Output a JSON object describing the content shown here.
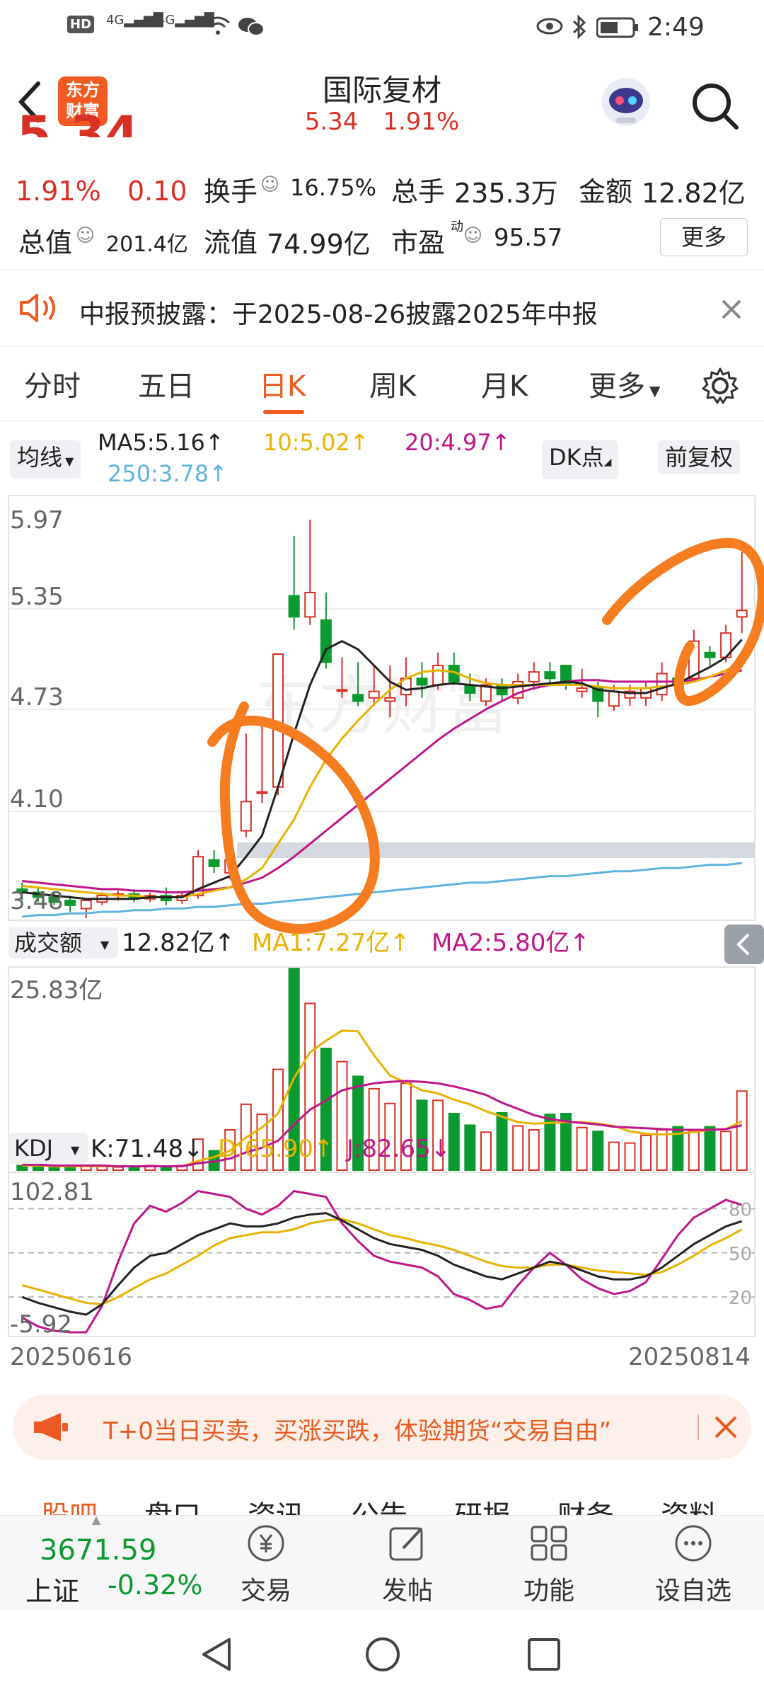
{
  "status_bar": {
    "left_icons": [
      "hd-icon",
      "4g-signal-icon",
      "4g-signal-icon",
      "wifi-icon",
      "wechat-icon"
    ],
    "hd_label": "HD",
    "sim1": "4G",
    "sim2": "4G",
    "time": "2:49"
  },
  "header": {
    "app_logo_line1": "东方",
    "app_logo_line2": "财富",
    "stock_name": "国际复材",
    "price": "5.34",
    "change_pct": "1.91%"
  },
  "quote": {
    "big_price": "5.34",
    "change_pct": "1.91%",
    "change_amt": "0.10",
    "turnover_label": "换手",
    "turnover_value": "16.75%",
    "total_hands_label": "总手",
    "total_hands_value": "235.3万",
    "amount_label": "金额",
    "amount_value": "12.82亿",
    "total_value_label": "总值",
    "total_value_value": "201.4亿",
    "float_value_label": "流值",
    "float_value_value": "74.99亿",
    "pe_label": "市盈",
    "pe_superscript": "动",
    "pe_value": "95.57",
    "more_button": "更多"
  },
  "notice": {
    "text": "中报预披露：于2025-08-26披露2025年中报"
  },
  "tabs": [
    "分时",
    "五日",
    "日K",
    "周K",
    "月K",
    "更多"
  ],
  "active_tab": "日K",
  "ma_row": {
    "selector": "均线",
    "ma5": "MA5:5.16",
    "ma10": "10:5.02",
    "ma20": "20:4.97",
    "ma250": "250:3.78",
    "dk_button": "DK点",
    "adjust_button": "前复权",
    "colors": {
      "ma5": "#222222",
      "ma10": "#e8b200",
      "ma20": "#c0168a",
      "ma250": "#5fb3e0"
    }
  },
  "chart_data": [
    {
      "type": "candlestick",
      "y_tick_labels": [
        "5.97",
        "5.35",
        "4.73",
        "4.10",
        "3.48"
      ],
      "ylim": [
        3.48,
        5.97
      ],
      "x_start": "20250616",
      "x_end": "20250814",
      "candles": [
        {
          "o": 3.62,
          "h": 3.66,
          "l": 3.55,
          "c": 3.6
        },
        {
          "o": 3.6,
          "h": 3.63,
          "l": 3.54,
          "c": 3.57
        },
        {
          "o": 3.57,
          "h": 3.6,
          "l": 3.52,
          "c": 3.54
        },
        {
          "o": 3.55,
          "h": 3.58,
          "l": 3.48,
          "c": 3.52
        },
        {
          "o": 3.5,
          "h": 3.56,
          "l": 3.44,
          "c": 3.55
        },
        {
          "o": 3.54,
          "h": 3.6,
          "l": 3.52,
          "c": 3.58
        },
        {
          "o": 3.58,
          "h": 3.61,
          "l": 3.55,
          "c": 3.59
        },
        {
          "o": 3.59,
          "h": 3.62,
          "l": 3.54,
          "c": 3.56
        },
        {
          "o": 3.56,
          "h": 3.6,
          "l": 3.54,
          "c": 3.58
        },
        {
          "o": 3.58,
          "h": 3.63,
          "l": 3.52,
          "c": 3.55
        },
        {
          "o": 3.55,
          "h": 3.6,
          "l": 3.53,
          "c": 3.58
        },
        {
          "o": 3.58,
          "h": 3.86,
          "l": 3.56,
          "c": 3.82
        },
        {
          "o": 3.8,
          "h": 3.86,
          "l": 3.72,
          "c": 3.76
        },
        {
          "o": 3.72,
          "h": 3.82,
          "l": 3.68,
          "c": 3.8
        },
        {
          "o": 3.98,
          "h": 4.58,
          "l": 3.94,
          "c": 4.16
        },
        {
          "o": 4.22,
          "h": 4.68,
          "l": 4.15,
          "c": 4.22
        },
        {
          "o": 4.25,
          "h": 5.07,
          "l": 4.2,
          "c": 5.07
        },
        {
          "o": 5.43,
          "h": 5.8,
          "l": 5.22,
          "c": 5.3
        },
        {
          "o": 5.3,
          "h": 5.9,
          "l": 5.25,
          "c": 5.45
        },
        {
          "o": 5.28,
          "h": 5.45,
          "l": 4.98,
          "c": 5.02
        },
        {
          "o": 4.85,
          "h": 5.05,
          "l": 4.8,
          "c": 4.85
        },
        {
          "o": 4.82,
          "h": 5.02,
          "l": 4.75,
          "c": 4.78
        },
        {
          "o": 4.8,
          "h": 5.0,
          "l": 4.75,
          "c": 4.84
        },
        {
          "o": 4.78,
          "h": 5.0,
          "l": 4.68,
          "c": 4.8
        },
        {
          "o": 4.82,
          "h": 5.05,
          "l": 4.75,
          "c": 4.92
        },
        {
          "o": 4.92,
          "h": 5.02,
          "l": 4.8,
          "c": 4.88
        },
        {
          "o": 4.88,
          "h": 5.08,
          "l": 4.85,
          "c": 5.0
        },
        {
          "o": 5.0,
          "h": 5.08,
          "l": 4.88,
          "c": 4.9
        },
        {
          "o": 4.88,
          "h": 4.95,
          "l": 4.78,
          "c": 4.83
        },
        {
          "o": 4.78,
          "h": 4.92,
          "l": 4.75,
          "c": 4.88
        },
        {
          "o": 4.88,
          "h": 4.92,
          "l": 4.78,
          "c": 4.82
        },
        {
          "o": 4.8,
          "h": 4.95,
          "l": 4.76,
          "c": 4.9
        },
        {
          "o": 4.9,
          "h": 5.02,
          "l": 4.85,
          "c": 4.96
        },
        {
          "o": 4.96,
          "h": 5.02,
          "l": 4.88,
          "c": 4.92
        },
        {
          "o": 5.0,
          "h": 5.0,
          "l": 4.85,
          "c": 4.88
        },
        {
          "o": 4.84,
          "h": 4.98,
          "l": 4.8,
          "c": 4.86
        },
        {
          "o": 4.86,
          "h": 4.9,
          "l": 4.68,
          "c": 4.78
        },
        {
          "o": 4.75,
          "h": 4.88,
          "l": 4.72,
          "c": 4.84
        },
        {
          "o": 4.8,
          "h": 4.88,
          "l": 4.75,
          "c": 4.84
        },
        {
          "o": 4.8,
          "h": 4.9,
          "l": 4.75,
          "c": 4.86
        },
        {
          "o": 4.82,
          "h": 5.02,
          "l": 4.78,
          "c": 4.95
        },
        {
          "o": 4.92,
          "h": 4.98,
          "l": 4.85,
          "c": 4.88
        },
        {
          "o": 4.92,
          "h": 5.22,
          "l": 4.9,
          "c": 5.15
        },
        {
          "o": 5.08,
          "h": 5.12,
          "l": 5.0,
          "c": 5.05
        },
        {
          "o": 5.05,
          "h": 5.25,
          "l": 5.02,
          "c": 5.2
        },
        {
          "o": 5.3,
          "h": 5.7,
          "l": 5.2,
          "c": 5.34
        }
      ],
      "ma5": [
        3.6,
        3.59,
        3.58,
        3.57,
        3.56,
        3.56,
        3.56,
        3.56,
        3.57,
        3.57,
        3.57,
        3.62,
        3.66,
        3.7,
        3.82,
        3.95,
        4.25,
        4.58,
        4.88,
        5.1,
        5.15,
        5.1,
        5.0,
        4.9,
        4.85,
        4.86,
        4.88,
        4.89,
        4.88,
        4.87,
        4.86,
        4.87,
        4.88,
        4.89,
        4.9,
        4.89,
        4.85,
        4.84,
        4.83,
        4.83,
        4.86,
        4.89,
        4.94,
        4.99,
        5.05,
        5.16
      ],
      "ma10": [
        3.64,
        3.63,
        3.62,
        3.61,
        3.6,
        3.59,
        3.58,
        3.58,
        3.57,
        3.57,
        3.57,
        3.59,
        3.61,
        3.63,
        3.68,
        3.75,
        3.9,
        4.05,
        4.25,
        4.42,
        4.55,
        4.66,
        4.76,
        4.85,
        4.92,
        4.96,
        4.97,
        4.96,
        4.92,
        4.89,
        4.88,
        4.88,
        4.88,
        4.88,
        4.88,
        4.88,
        4.87,
        4.86,
        4.86,
        4.86,
        4.87,
        4.88,
        4.9,
        4.93,
        4.97,
        5.02
      ],
      "ma20": [
        3.67,
        3.66,
        3.65,
        3.64,
        3.63,
        3.62,
        3.62,
        3.61,
        3.61,
        3.6,
        3.6,
        3.61,
        3.62,
        3.63,
        3.66,
        3.69,
        3.75,
        3.82,
        3.9,
        3.98,
        4.06,
        4.14,
        4.22,
        4.3,
        4.38,
        4.46,
        4.54,
        4.61,
        4.67,
        4.73,
        4.78,
        4.83,
        4.86,
        4.88,
        4.9,
        4.91,
        4.91,
        4.9,
        4.9,
        4.9,
        4.9,
        4.9,
        4.91,
        4.93,
        4.95,
        4.97
      ],
      "ma250": [
        3.45,
        3.46,
        3.46,
        3.47,
        3.47,
        3.48,
        3.48,
        3.49,
        3.49,
        3.5,
        3.5,
        3.51,
        3.51,
        3.52,
        3.53,
        3.53,
        3.54,
        3.55,
        3.56,
        3.57,
        3.58,
        3.59,
        3.6,
        3.61,
        3.62,
        3.63,
        3.64,
        3.65,
        3.66,
        3.66,
        3.67,
        3.68,
        3.69,
        3.7,
        3.7,
        3.71,
        3.72,
        3.73,
        3.73,
        3.74,
        3.75,
        3.75,
        3.76,
        3.77,
        3.77,
        3.78
      ]
    },
    {
      "type": "bar",
      "label": "成交额",
      "current": "12.82亿",
      "ma1": "MA1:7.27亿",
      "ma2": "MA2:5.80亿",
      "y_tick_label": "25.83亿",
      "ylim": [
        0,
        25.83
      ],
      "values": [
        0.6,
        0.5,
        0.4,
        0.5,
        0.6,
        0.5,
        0.4,
        0.5,
        0.6,
        0.5,
        0.6,
        4.0,
        2.5,
        5.2,
        8.5,
        7.2,
        13.0,
        26.0,
        21.5,
        15.7,
        14.0,
        12.1,
        10.5,
        8.6,
        11.2,
        9.0,
        9.0,
        7.3,
        5.8,
        4.9,
        7.4,
        5.7,
        5.2,
        7.2,
        7.3,
        5.5,
        5.0,
        3.6,
        3.5,
        4.5,
        5.2,
        5.6,
        5.1,
        5.6,
        5.0,
        10.2
      ],
      "ma1_values": [
        0.6,
        0.6,
        0.5,
        0.5,
        0.5,
        0.5,
        0.5,
        0.5,
        0.5,
        0.5,
        0.5,
        1.2,
        1.7,
        2.5,
        4.2,
        5.5,
        7.3,
        11.9,
        15.2,
        16.7,
        18.0,
        17.9,
        14.8,
        12.2,
        11.3,
        10.3,
        9.9,
        9.1,
        8.5,
        7.6,
        6.9,
        6.2,
        6.0,
        6.1,
        6.2,
        6.2,
        6.0,
        5.7,
        5.0,
        4.7,
        4.6,
        4.7,
        4.9,
        5.2,
        5.3,
        6.3
      ],
      "ma2_values": [
        0.7,
        0.7,
        0.6,
        0.6,
        0.6,
        0.6,
        0.5,
        0.5,
        0.5,
        0.5,
        0.5,
        0.9,
        1.1,
        1.5,
        2.3,
        2.9,
        3.8,
        5.9,
        7.8,
        9.0,
        10.3,
        10.8,
        11.2,
        11.4,
        11.5,
        11.4,
        11.2,
        10.8,
        10.3,
        9.7,
        8.7,
        7.9,
        7.1,
        6.6,
        6.3,
        6.1,
        5.9,
        5.6,
        5.5,
        5.4,
        5.3,
        5.2,
        5.2,
        5.2,
        5.3,
        5.8
      ],
      "colors": {
        "ma1": "#e8b200",
        "ma2": "#c0168a"
      }
    },
    {
      "type": "line",
      "label": "KDJ",
      "k": "K:71.48",
      "d": "D:65.90",
      "j": "J:82.65",
      "y_tick_labels": [
        "102.81",
        "-5.92"
      ],
      "ylim": [
        -5.92,
        102.81
      ],
      "ref_levels": [
        "80",
        "50",
        "20"
      ],
      "k_values": [
        20,
        16,
        13,
        10,
        8,
        15,
        28,
        40,
        48,
        50,
        56,
        62,
        66,
        70,
        68,
        68,
        70,
        74,
        76,
        77,
        72,
        66,
        60,
        56,
        54,
        52,
        48,
        42,
        38,
        34,
        32,
        36,
        40,
        44,
        42,
        38,
        34,
        32,
        32,
        34,
        40,
        48,
        56,
        62,
        68,
        71.48
      ],
      "d_values": [
        28,
        25,
        22,
        19,
        16,
        15,
        20,
        26,
        32,
        36,
        42,
        48,
        55,
        60,
        62,
        64,
        64,
        66,
        70,
        72,
        73,
        70,
        66,
        62,
        60,
        57,
        55,
        52,
        48,
        44,
        41,
        40,
        40,
        42,
        42,
        40,
        38,
        37,
        36,
        35,
        37,
        42,
        48,
        55,
        60,
        65.9
      ],
      "j_values": [
        6,
        0,
        -3,
        -4,
        -4,
        14,
        44,
        70,
        82,
        78,
        84,
        92,
        90,
        88,
        80,
        76,
        82,
        92,
        90,
        88,
        70,
        58,
        48,
        44,
        42,
        40,
        34,
        22,
        18,
        12,
        14,
        28,
        40,
        50,
        42,
        32,
        26,
        22,
        24,
        30,
        46,
        62,
        74,
        80,
        86,
        82.65
      ],
      "colors": {
        "k": "#222222",
        "d": "#e8b200",
        "j": "#c0168a"
      }
    }
  ],
  "ad_banner": {
    "text": "T+0当日买卖，买涨买跌，体验期货“交易自由”"
  },
  "sub_tabs": [
    "股吧",
    "盘口",
    "资讯",
    "公告",
    "研报",
    "财务",
    "资料"
  ],
  "bottom_nav": {
    "index_value": "3671.59",
    "index_name": "上证",
    "index_change": "-0.32%",
    "items": [
      "交易",
      "发帖",
      "功能",
      "设自选"
    ]
  }
}
